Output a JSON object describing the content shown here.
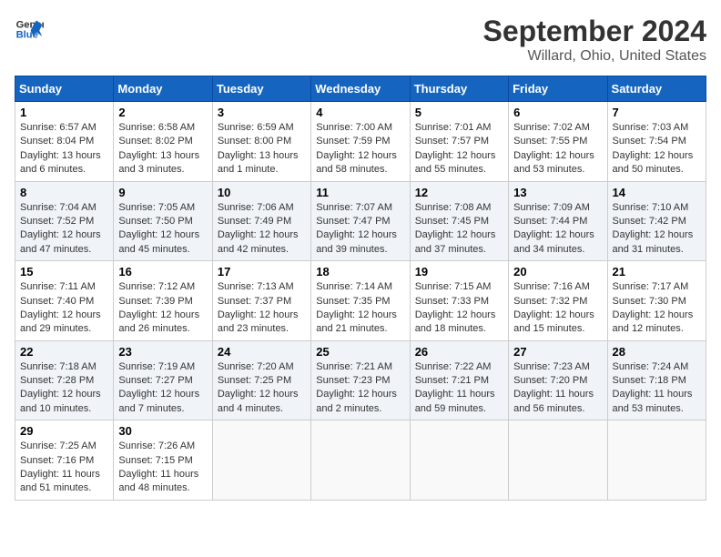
{
  "logo": {
    "line1": "General",
    "line2": "Blue"
  },
  "title": "September 2024",
  "location": "Willard, Ohio, United States",
  "days_of_week": [
    "Sunday",
    "Monday",
    "Tuesday",
    "Wednesday",
    "Thursday",
    "Friday",
    "Saturday"
  ],
  "weeks": [
    [
      {
        "day": "1",
        "info": "Sunrise: 6:57 AM\nSunset: 8:04 PM\nDaylight: 13 hours\nand 6 minutes."
      },
      {
        "day": "2",
        "info": "Sunrise: 6:58 AM\nSunset: 8:02 PM\nDaylight: 13 hours\nand 3 minutes."
      },
      {
        "day": "3",
        "info": "Sunrise: 6:59 AM\nSunset: 8:00 PM\nDaylight: 13 hours\nand 1 minute."
      },
      {
        "day": "4",
        "info": "Sunrise: 7:00 AM\nSunset: 7:59 PM\nDaylight: 12 hours\nand 58 minutes."
      },
      {
        "day": "5",
        "info": "Sunrise: 7:01 AM\nSunset: 7:57 PM\nDaylight: 12 hours\nand 55 minutes."
      },
      {
        "day": "6",
        "info": "Sunrise: 7:02 AM\nSunset: 7:55 PM\nDaylight: 12 hours\nand 53 minutes."
      },
      {
        "day": "7",
        "info": "Sunrise: 7:03 AM\nSunset: 7:54 PM\nDaylight: 12 hours\nand 50 minutes."
      }
    ],
    [
      {
        "day": "8",
        "info": "Sunrise: 7:04 AM\nSunset: 7:52 PM\nDaylight: 12 hours\nand 47 minutes."
      },
      {
        "day": "9",
        "info": "Sunrise: 7:05 AM\nSunset: 7:50 PM\nDaylight: 12 hours\nand 45 minutes."
      },
      {
        "day": "10",
        "info": "Sunrise: 7:06 AM\nSunset: 7:49 PM\nDaylight: 12 hours\nand 42 minutes."
      },
      {
        "day": "11",
        "info": "Sunrise: 7:07 AM\nSunset: 7:47 PM\nDaylight: 12 hours\nand 39 minutes."
      },
      {
        "day": "12",
        "info": "Sunrise: 7:08 AM\nSunset: 7:45 PM\nDaylight: 12 hours\nand 37 minutes."
      },
      {
        "day": "13",
        "info": "Sunrise: 7:09 AM\nSunset: 7:44 PM\nDaylight: 12 hours\nand 34 minutes."
      },
      {
        "day": "14",
        "info": "Sunrise: 7:10 AM\nSunset: 7:42 PM\nDaylight: 12 hours\nand 31 minutes."
      }
    ],
    [
      {
        "day": "15",
        "info": "Sunrise: 7:11 AM\nSunset: 7:40 PM\nDaylight: 12 hours\nand 29 minutes."
      },
      {
        "day": "16",
        "info": "Sunrise: 7:12 AM\nSunset: 7:39 PM\nDaylight: 12 hours\nand 26 minutes."
      },
      {
        "day": "17",
        "info": "Sunrise: 7:13 AM\nSunset: 7:37 PM\nDaylight: 12 hours\nand 23 minutes."
      },
      {
        "day": "18",
        "info": "Sunrise: 7:14 AM\nSunset: 7:35 PM\nDaylight: 12 hours\nand 21 minutes."
      },
      {
        "day": "19",
        "info": "Sunrise: 7:15 AM\nSunset: 7:33 PM\nDaylight: 12 hours\nand 18 minutes."
      },
      {
        "day": "20",
        "info": "Sunrise: 7:16 AM\nSunset: 7:32 PM\nDaylight: 12 hours\nand 15 minutes."
      },
      {
        "day": "21",
        "info": "Sunrise: 7:17 AM\nSunset: 7:30 PM\nDaylight: 12 hours\nand 12 minutes."
      }
    ],
    [
      {
        "day": "22",
        "info": "Sunrise: 7:18 AM\nSunset: 7:28 PM\nDaylight: 12 hours\nand 10 minutes."
      },
      {
        "day": "23",
        "info": "Sunrise: 7:19 AM\nSunset: 7:27 PM\nDaylight: 12 hours\nand 7 minutes."
      },
      {
        "day": "24",
        "info": "Sunrise: 7:20 AM\nSunset: 7:25 PM\nDaylight: 12 hours\nand 4 minutes."
      },
      {
        "day": "25",
        "info": "Sunrise: 7:21 AM\nSunset: 7:23 PM\nDaylight: 12 hours\nand 2 minutes."
      },
      {
        "day": "26",
        "info": "Sunrise: 7:22 AM\nSunset: 7:21 PM\nDaylight: 11 hours\nand 59 minutes."
      },
      {
        "day": "27",
        "info": "Sunrise: 7:23 AM\nSunset: 7:20 PM\nDaylight: 11 hours\nand 56 minutes."
      },
      {
        "day": "28",
        "info": "Sunrise: 7:24 AM\nSunset: 7:18 PM\nDaylight: 11 hours\nand 53 minutes."
      }
    ],
    [
      {
        "day": "29",
        "info": "Sunrise: 7:25 AM\nSunset: 7:16 PM\nDaylight: 11 hours\nand 51 minutes."
      },
      {
        "day": "30",
        "info": "Sunrise: 7:26 AM\nSunset: 7:15 PM\nDaylight: 11 hours\nand 48 minutes."
      },
      {
        "day": "",
        "info": ""
      },
      {
        "day": "",
        "info": ""
      },
      {
        "day": "",
        "info": ""
      },
      {
        "day": "",
        "info": ""
      },
      {
        "day": "",
        "info": ""
      }
    ]
  ]
}
